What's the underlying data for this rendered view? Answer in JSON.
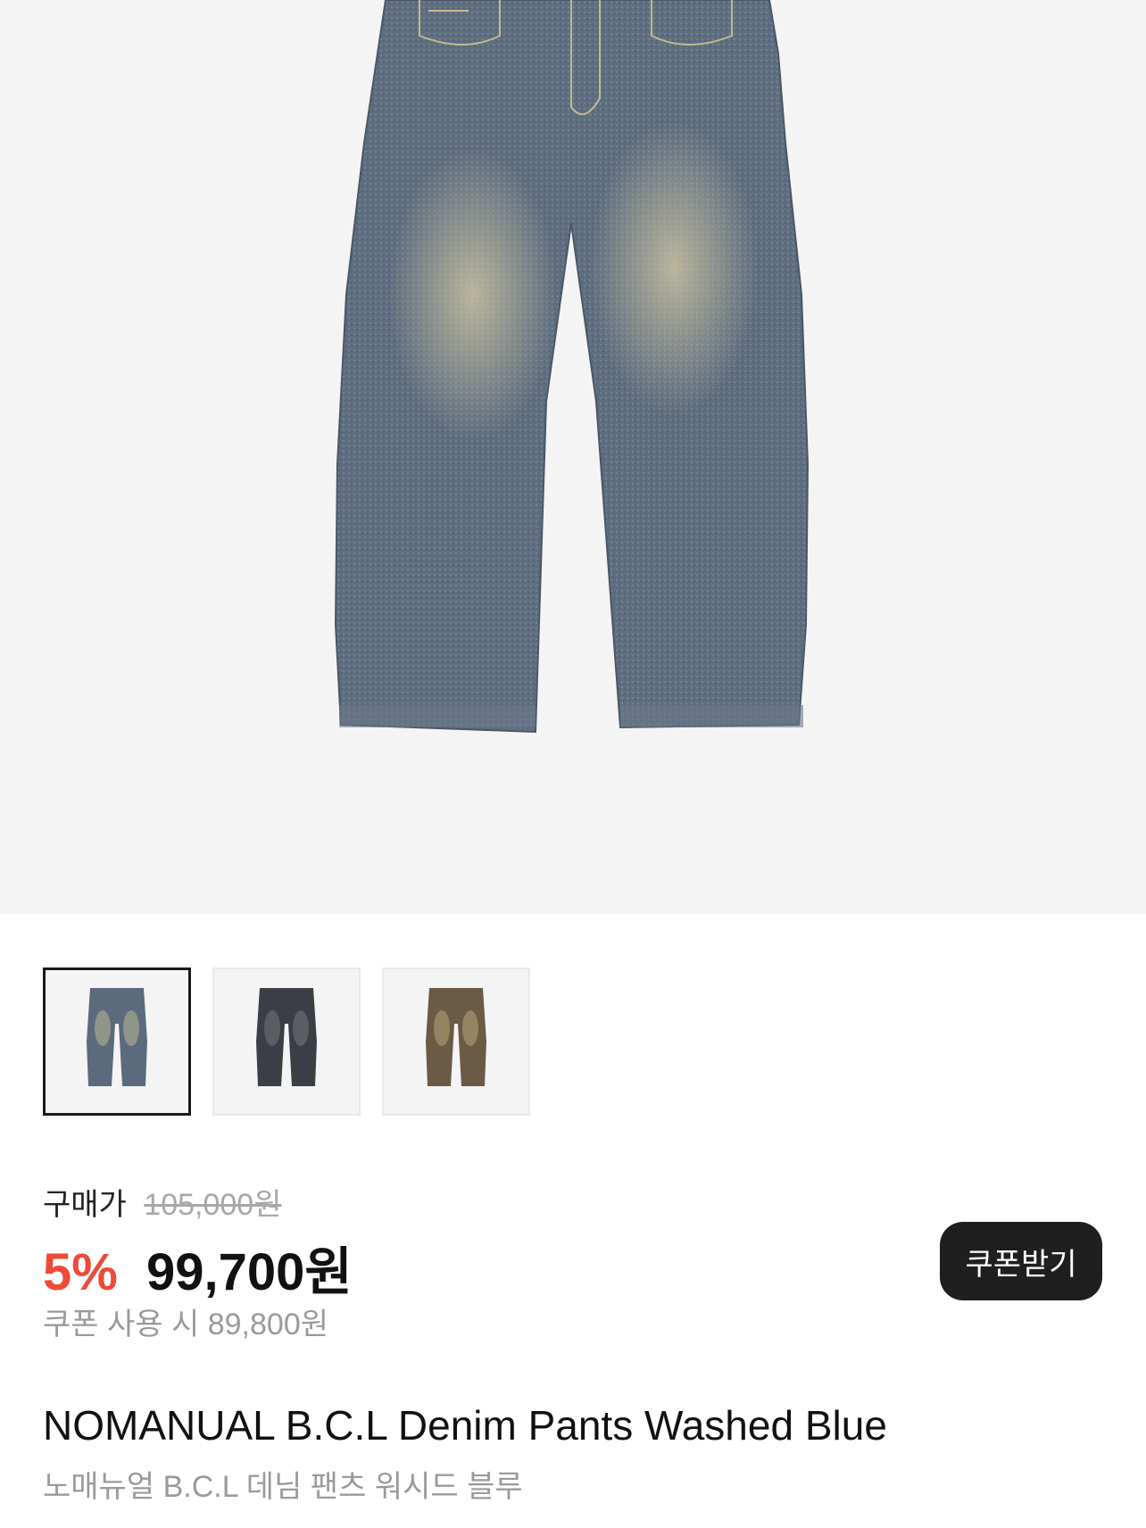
{
  "product_image": {
    "alt_icon": "denim-pants-washed-blue"
  },
  "thumbnails": [
    {
      "name": "washed-blue",
      "color": "#5b6a7c",
      "selected": true
    },
    {
      "name": "washed-black",
      "color": "#3b3e44",
      "selected": false
    },
    {
      "name": "washed-brown",
      "color": "#6b5a45",
      "selected": false
    }
  ],
  "pricing": {
    "label": "구매가",
    "original_price": "105,000원",
    "discount": "5%",
    "final_price": "99,700원",
    "coupon_price": "쿠폰 사용 시 89,800원",
    "coupon_button": "쿠폰받기",
    "discount_color": "#ee4a3a"
  },
  "product": {
    "title_en": "NOMANUAL B.C.L Denim Pants Washed Blue",
    "title_ko": "노매뉴얼 B.C.L 데님 팬츠 워시드 블루"
  }
}
